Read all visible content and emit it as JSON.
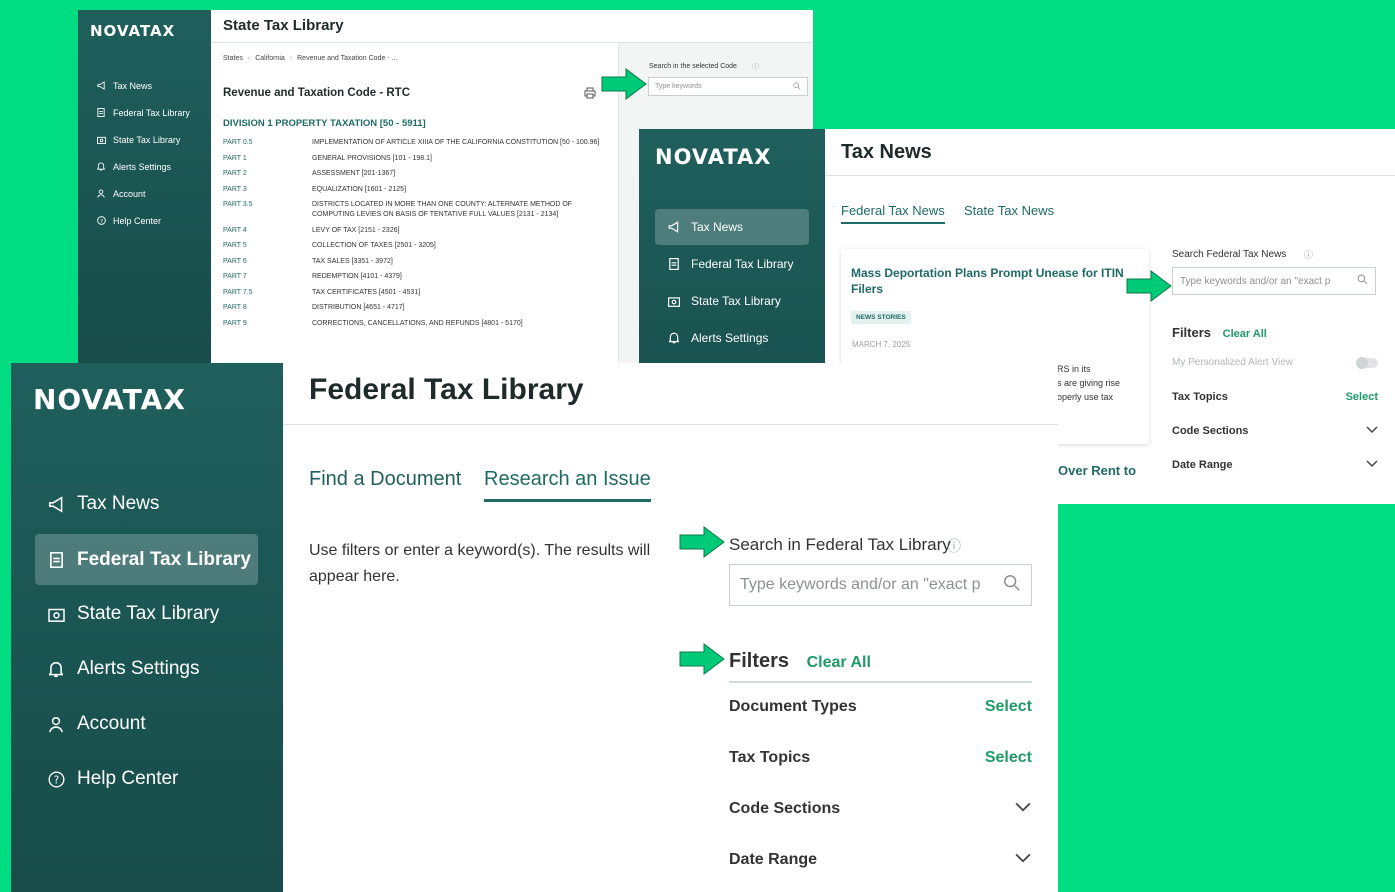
{
  "logo": "NOVATAX",
  "nav": {
    "tax_news": "Tax News",
    "federal": "Federal Tax Library",
    "state": "State Tax Library",
    "alerts": "Alerts Settings",
    "account": "Account",
    "help": "Help Center"
  },
  "state_shot": {
    "title": "State Tax Library",
    "breadcrumb": [
      "States",
      "California",
      "Revenue and Taxation Code - ..."
    ],
    "code_title": "Revenue and Taxation Code - RTC",
    "search_label": "Search in the selected Code",
    "search_placeholder": "Type keywords",
    "division": "DIVISION 1 PROPERTY TAXATION [50 - 5911]",
    "parts": [
      {
        "part": "PART 0.5",
        "desc": "IMPLEMENTATION OF ARTICLE XIIIA OF THE CALIFORNIA CONSTITUTION [50 - 100.96]"
      },
      {
        "part": "PART 1",
        "desc": "GENERAL PROVISIONS [101 - 198.1]"
      },
      {
        "part": "PART 2",
        "desc": "ASSESSMENT [201-1367]"
      },
      {
        "part": "PART 3",
        "desc": "EQUALIZATION [1601 - 2125]"
      },
      {
        "part": "PART 3.5",
        "desc": "DISTRICTS LOCATED IN MORE THAN ONE COUNTY: ALTERNATE METHOD OF COMPUTING LEVIES ON BASIS OF TENTATIVE FULL VALUES [2131 - 2134]"
      },
      {
        "part": "PART 4",
        "desc": "LEVY OF TAX [2151 - 2326]"
      },
      {
        "part": "PART 5",
        "desc": "COLLECTION OF TAXES [2501 - 3205]"
      },
      {
        "part": "PART 6",
        "desc": "TAX SALES [3351 - 3972]"
      },
      {
        "part": "PART 7",
        "desc": "REDEMPTION [4101 - 4379]"
      },
      {
        "part": "PART 7.5",
        "desc": "TAX CERTIFICATES [4501 - 4531]"
      },
      {
        "part": "PART 8",
        "desc": "DISTRIBUTION [4651 - 4717]"
      },
      {
        "part": "PART 9",
        "desc": "CORRECTIONS, CANCELLATIONS, AND REFUNDS [4801 - 5170]"
      }
    ]
  },
  "news_shot": {
    "title": "Tax News",
    "tab_federal": "Federal Tax News",
    "tab_state": "State Tax News",
    "article_title": "Mass Deportation Plans Prompt Unease for ITIN Filers",
    "article_tag": "NEWS STORIES",
    "article_date": "MARCH 7, 2025",
    "snippet": [
      "RS in its",
      "s are giving rise",
      "operly use tax"
    ],
    "article2": "Over Rent to",
    "search_label": "Search Federal Tax News",
    "search_placeholder": "Type keywords and/or an \"exact p",
    "filters": "Filters",
    "clear_all": "Clear All",
    "alert_view": "My Personalized Alert View",
    "tax_topics": "Tax Topics",
    "select": "Select",
    "code_sections": "Code Sections",
    "date_range": "Date Range"
  },
  "fed_shot": {
    "title": "Federal Tax Library",
    "tab_find": "Find a Document",
    "tab_research": "Research an Issue",
    "hint": "Use filters or enter a keyword(s). The results will appear here.",
    "search_label": "Search in Federal Tax Library",
    "search_placeholder": "Type keywords and/or an \"exact p",
    "filters": "Filters",
    "clear_all": "Clear All",
    "doc_types": "Document Types",
    "tax_topics": "Tax Topics",
    "select": "Select",
    "code_sections": "Code Sections",
    "date_range": "Date Range"
  },
  "colors": {
    "background": "#00dc82",
    "sidebar": "#1f5f5c",
    "accent": "#1f6a66",
    "link": "#17a06a"
  }
}
